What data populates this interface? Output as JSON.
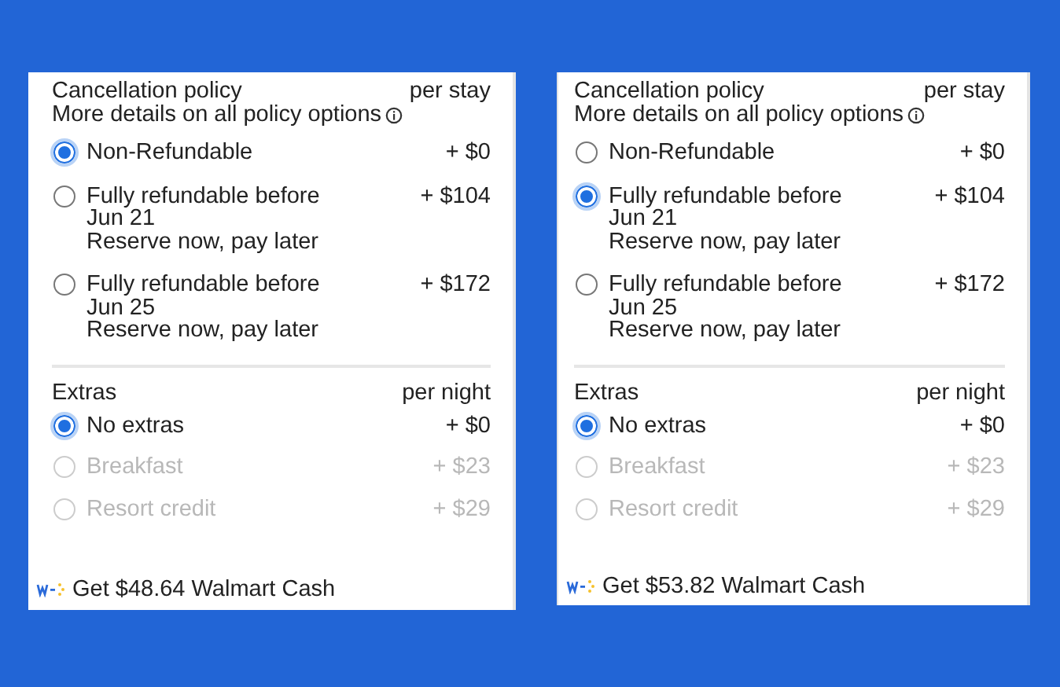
{
  "panels": [
    {
      "cancellation": {
        "title": "Cancellation policy",
        "unit": "per stay",
        "details": "More details on all policy options",
        "options": [
          {
            "label": "Non-Refundable",
            "price": "+ $0",
            "selected": true
          },
          {
            "label": "Fully refundable before Jun 21",
            "note": "Reserve now, pay later",
            "price": "+ $104",
            "selected": false
          },
          {
            "label": "Fully refundable before Jun 25",
            "note": "Reserve now, pay later",
            "price": "+ $172",
            "selected": false
          }
        ]
      },
      "extras": {
        "title": "Extras",
        "unit": "per night",
        "options": [
          {
            "label": "No extras",
            "price": "+ $0",
            "selected": true,
            "disabled": false
          },
          {
            "label": "Breakfast",
            "price": "+ $23",
            "selected": false,
            "disabled": true
          },
          {
            "label": "Resort credit",
            "price": "+ $29",
            "selected": false,
            "disabled": true
          }
        ]
      },
      "cash": "Get $48.64 Walmart Cash"
    },
    {
      "cancellation": {
        "title": "Cancellation policy",
        "unit": "per stay",
        "details": "More details on all policy options",
        "options": [
          {
            "label": "Non-Refundable",
            "price": "+ $0",
            "selected": false
          },
          {
            "label": "Fully refundable before Jun 21",
            "note": "Reserve now, pay later",
            "price": "+ $104",
            "selected": true
          },
          {
            "label": "Fully refundable before Jun 25",
            "note": "Reserve now, pay later",
            "price": "+ $172",
            "selected": false
          }
        ]
      },
      "extras": {
        "title": "Extras",
        "unit": "per night",
        "options": [
          {
            "label": "No extras",
            "price": "+ $0",
            "selected": true,
            "disabled": false
          },
          {
            "label": "Breakfast",
            "price": "+ $23",
            "selected": false,
            "disabled": true
          },
          {
            "label": "Resort credit",
            "price": "+ $29",
            "selected": false,
            "disabled": true
          }
        ]
      },
      "cash": "Get $53.82 Walmart Cash"
    }
  ]
}
